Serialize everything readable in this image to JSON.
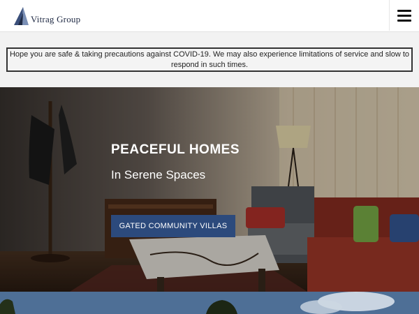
{
  "header": {
    "logo_text": "Vitrag Group",
    "logo_icon": "vitrag-logo-mark",
    "menu_icon": "hamburger-menu-icon"
  },
  "notice": {
    "text": "Hope you are safe & taking precautions against COVID-19. We may also experience limitations of service and slow to respond in such times."
  },
  "hero": {
    "title": "PEACEFUL HOMES",
    "subtitle": "In Serene Spaces",
    "cta_label": "GATED COMMUNITY VILLAS"
  },
  "colors": {
    "brand_navy": "#2c4a7c",
    "logo_text": "#1f2a44",
    "page_bg": "#f2f2f2"
  }
}
